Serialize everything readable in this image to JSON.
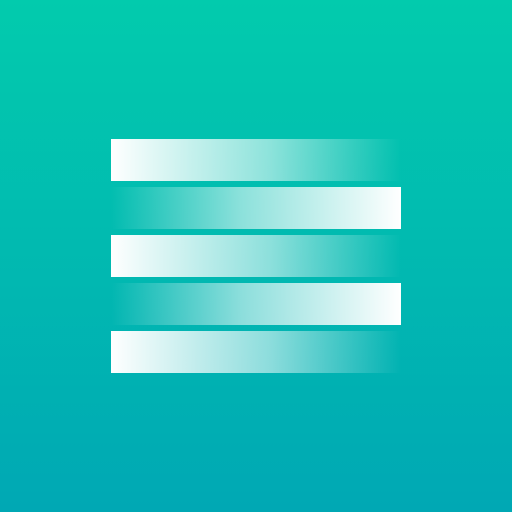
{
  "icon": {
    "name": "striped-lines-app-icon",
    "background_top": "#02cbad",
    "background_bottom": "#00a8b4",
    "stripe_color": "#ffffff",
    "stripes": [
      {
        "fade": "to-right"
      },
      {
        "fade": "to-left"
      },
      {
        "fade": "to-right"
      },
      {
        "fade": "to-left"
      },
      {
        "fade": "to-right"
      }
    ]
  }
}
